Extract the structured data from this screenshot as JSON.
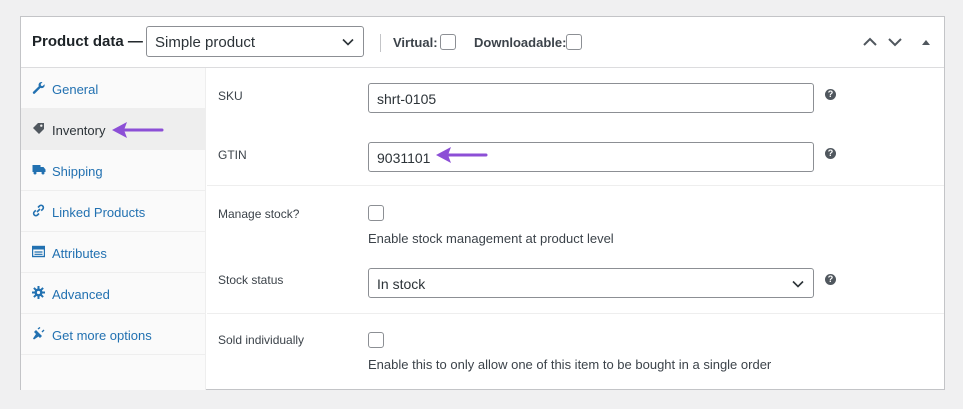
{
  "header": {
    "title": "Product data —",
    "product_type": "Simple product",
    "virtual_label": "Virtual:",
    "downloadable_label": "Downloadable:"
  },
  "sidebar": {
    "items": [
      {
        "label": "General",
        "icon": "wrench-icon"
      },
      {
        "label": "Inventory",
        "icon": "tag-icon",
        "active": true
      },
      {
        "label": "Shipping",
        "icon": "truck-icon"
      },
      {
        "label": "Linked Products",
        "icon": "link-icon"
      },
      {
        "label": "Attributes",
        "icon": "table-icon"
      },
      {
        "label": "Advanced",
        "icon": "gear-icon"
      },
      {
        "label": "Get more options",
        "icon": "plugin-icon"
      }
    ]
  },
  "fields": {
    "sku_label": "SKU",
    "sku_value": "shrt-0105",
    "gtin_label": "GTIN",
    "gtin_value": "9031101",
    "manage_stock_label": "Manage stock?",
    "manage_stock_desc": "Enable stock management at product level",
    "stock_status_label": "Stock status",
    "stock_status_value": "In stock",
    "sold_individually_label": "Sold individually",
    "sold_individually_desc": "Enable this to only allow one of this item to be bought in a single order"
  },
  "help_glyph": "?",
  "colors": {
    "link": "#2271b1",
    "annotation_arrow": "#8c4fd6"
  }
}
